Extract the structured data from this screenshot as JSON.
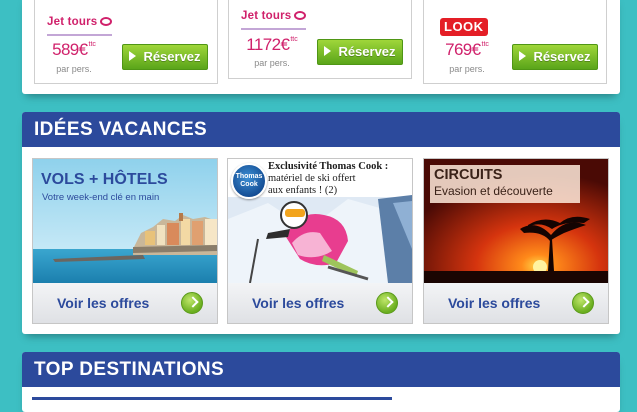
{
  "offers": [
    {
      "brand": "Jet tours",
      "price": "589€",
      "price_suffix": "ttc",
      "per_person": "par pers.",
      "button": "Réservez"
    },
    {
      "brand": "Jet tours",
      "price": "1172€",
      "price_suffix": "ttc",
      "per_person": "par pers.",
      "button": "Réservez"
    },
    {
      "brand": "LOOK",
      "price": "769€",
      "price_suffix": "ttc",
      "per_person": "par pers.",
      "button": "Réservez"
    }
  ],
  "ideas": {
    "title": "IDÉES VACANCES",
    "cards": [
      {
        "title": "VOLS + HÔTELS",
        "subtitle": "Votre week-end clé en main",
        "cta": "Voir les offres"
      },
      {
        "badge": "Thomas Cook",
        "headline": "Exclusivité Thomas Cook :",
        "line1": "matériel de ski offert",
        "line2": "aux enfants ! (2)",
        "cta": "Voir les offres"
      },
      {
        "title": "CIRCUITS",
        "subtitle": "Evasion et découverte",
        "cta": "Voir les offres"
      }
    ]
  },
  "top_destinations": {
    "title": "TOP DESTINATIONS"
  },
  "colors": {
    "background": "#3dbfc3",
    "header_blue": "#2c4a9c",
    "price_pink": "#d0216b",
    "button_green": "#6aae1f"
  }
}
